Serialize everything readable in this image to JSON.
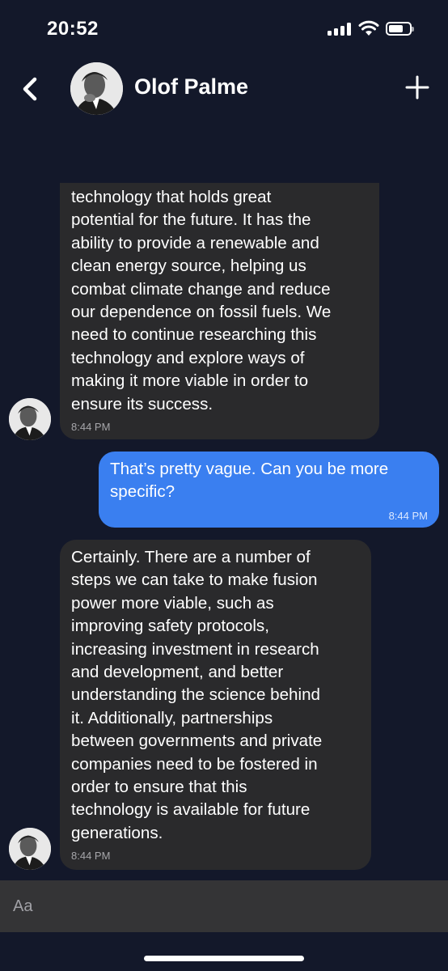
{
  "status_bar": {
    "time": "20:52"
  },
  "header": {
    "contact_name": "Olof Palme"
  },
  "messages": [
    {
      "direction": "incoming",
      "text": "technology that holds great\npotential for the future. It has the\nability to provide a renewable and\nclean energy source, helping us\ncombat climate change and reduce\nour dependence on fossil fuels. We\nneed to continue researching this\ntechnology and explore ways of\nmaking it more viable in order to\nensure its success.",
      "time": "8:44 PM"
    },
    {
      "direction": "outgoing",
      "text": "That’s pretty vague. Can you be more\nspecific?",
      "time": "8:44 PM"
    },
    {
      "direction": "incoming",
      "text": "Certainly. There are a number of\nsteps we can take to make fusion\npower more viable, such as\nimproving safety protocols,\nincreasing investment in research\nand development, and better\nunderstanding the science behind\nit. Additionally, partnerships\nbetween governments and private\ncompanies need to be fostered in\norder to ensure that this\ntechnology is available for future\ngenerations.",
      "time": "8:44 PM"
    }
  ],
  "composer": {
    "placeholder": "Aa"
  },
  "icons": [
    "signal-icon",
    "wifi-icon",
    "battery-icon",
    "back-chevron-icon",
    "plus-icon"
  ],
  "colors": {
    "background": "#13182a",
    "incoming_bubble": "#2a2a2c",
    "outgoing_bubble": "#3a7ff0",
    "composer": "#343436"
  }
}
